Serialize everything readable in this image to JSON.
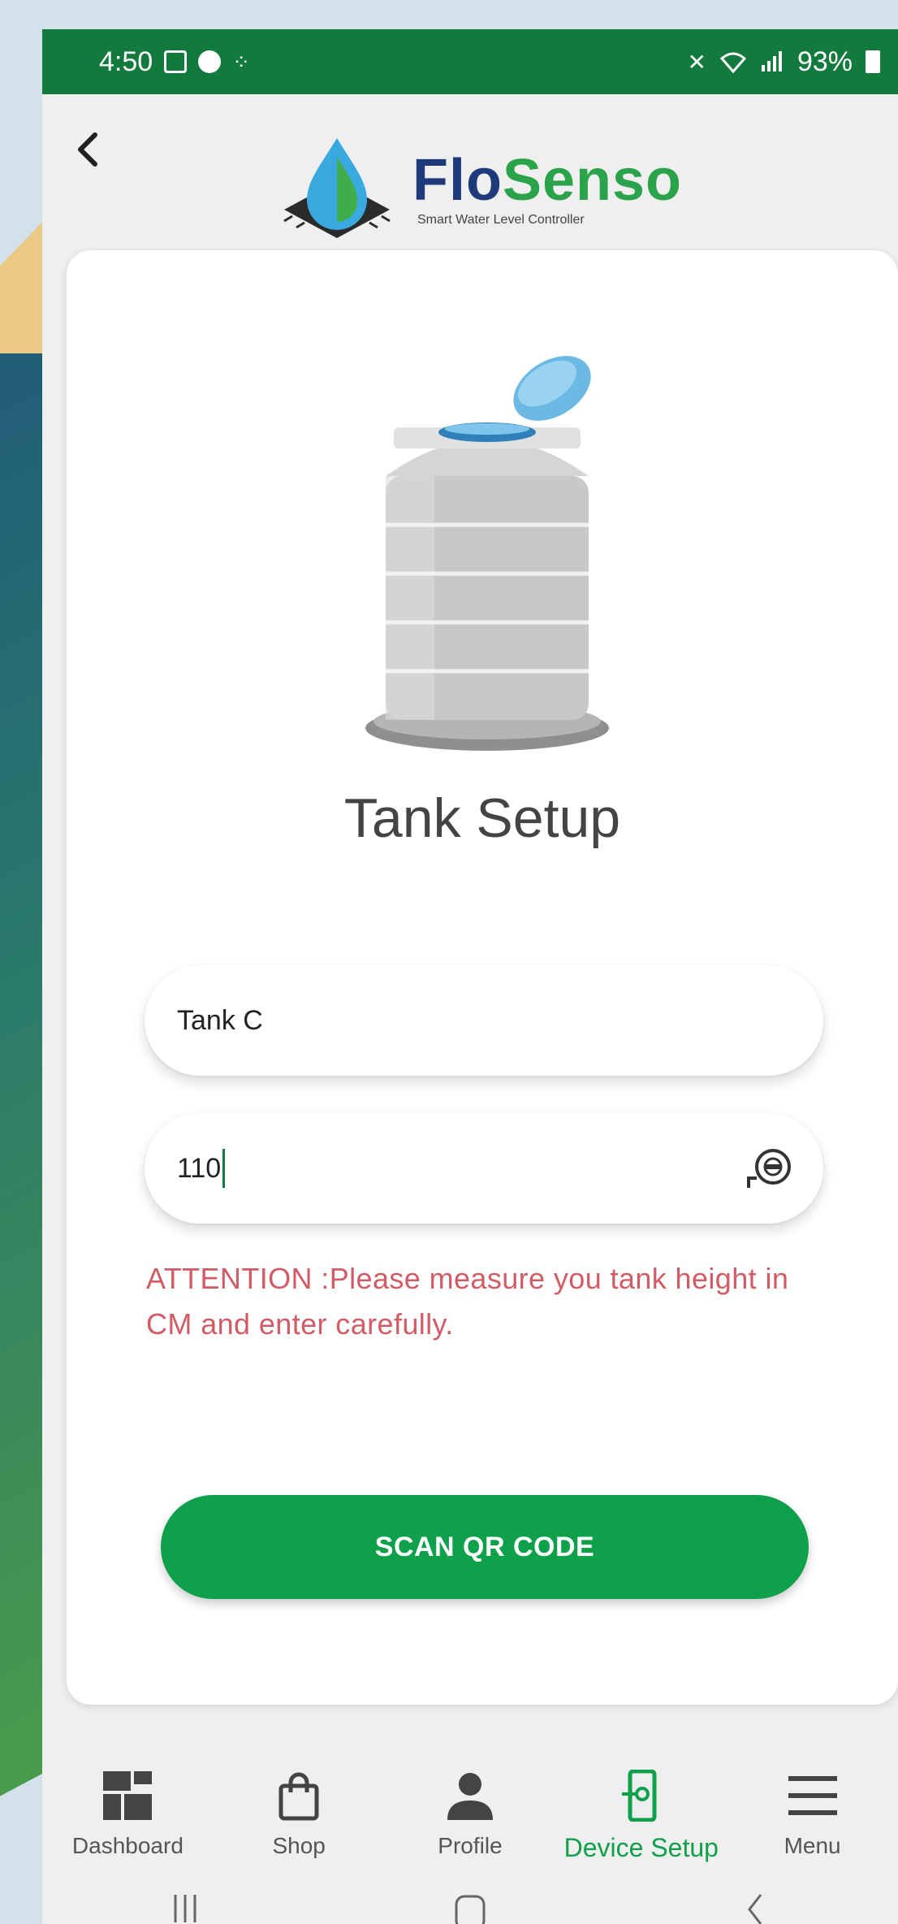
{
  "status_bar": {
    "time": "4:50",
    "battery": "93%"
  },
  "header": {
    "logo_flo": "Flo",
    "logo_senso": "Senso",
    "logo_tagline": "Smart Water Level Controller"
  },
  "form": {
    "title": "Tank Setup",
    "tank_name_value": "Tank C",
    "tank_height_value": "110",
    "attention_text": "ATTENTION :Please measure you tank height in CM and enter carefully.",
    "scan_button": "SCAN QR CODE"
  },
  "bottom_nav": {
    "items": [
      {
        "label": "Dashboard",
        "icon": "dashboard-grid-icon"
      },
      {
        "label": "Shop",
        "icon": "shopping-bag-icon"
      },
      {
        "label": "Profile",
        "icon": "person-icon"
      },
      {
        "label": "Device Setup",
        "icon": "device-setup-icon",
        "active": true
      },
      {
        "label": "Menu",
        "icon": "hamburger-menu-icon"
      }
    ]
  },
  "colors": {
    "brand_green": "#137a3e",
    "button_green": "#0ea04a",
    "warning_red": "#d15c66"
  }
}
